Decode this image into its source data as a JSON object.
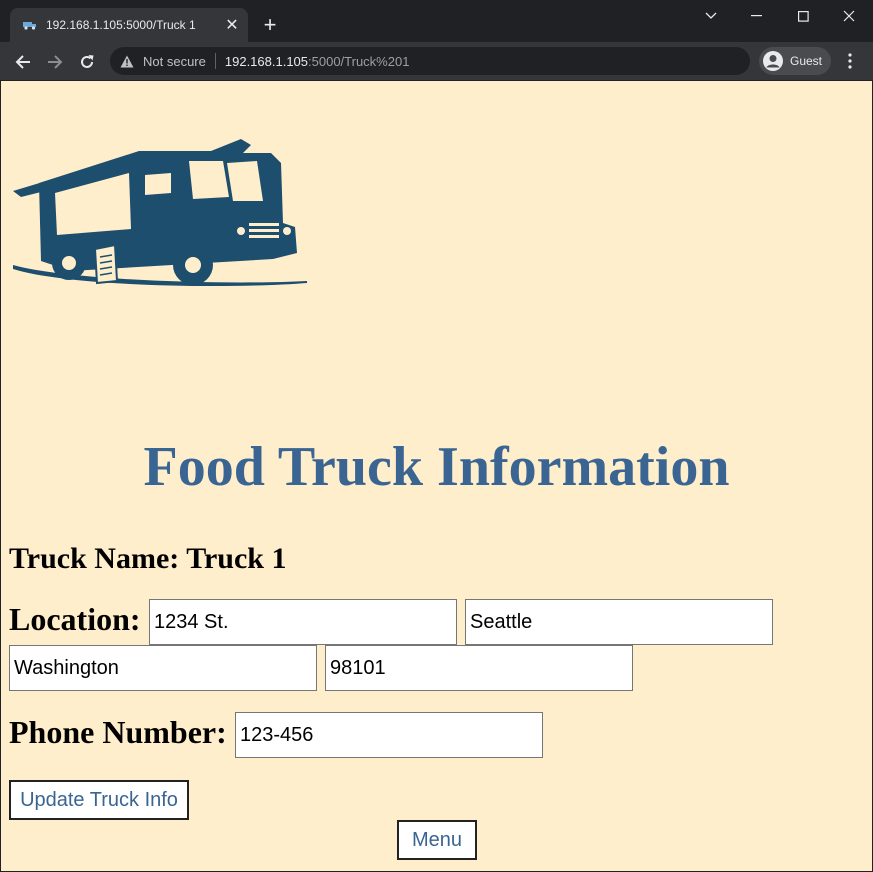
{
  "browser": {
    "tab_title": "192.168.1.105:5000/Truck 1",
    "tab_close": "✕",
    "new_tab": "+",
    "omnibox": {
      "security_label": "Not secure",
      "host": "192.168.1.105",
      "path": ":5000/Truck%201"
    },
    "profile_label": "Guest"
  },
  "page": {
    "title": "Food Truck Information",
    "truck_name_label": "Truck Name: Truck 1",
    "location_label": "Location:",
    "location": {
      "street": "1234 St.",
      "city": "Seattle",
      "state": "Washington",
      "zip": "98101"
    },
    "phone_label": "Phone Number:",
    "phone": "123-456",
    "update_button": "Update Truck Info",
    "menu_button": "Menu"
  },
  "colors": {
    "page_background": "#ffeecc",
    "title": "#3a6592",
    "truck_logo": "#1d4e6e"
  }
}
